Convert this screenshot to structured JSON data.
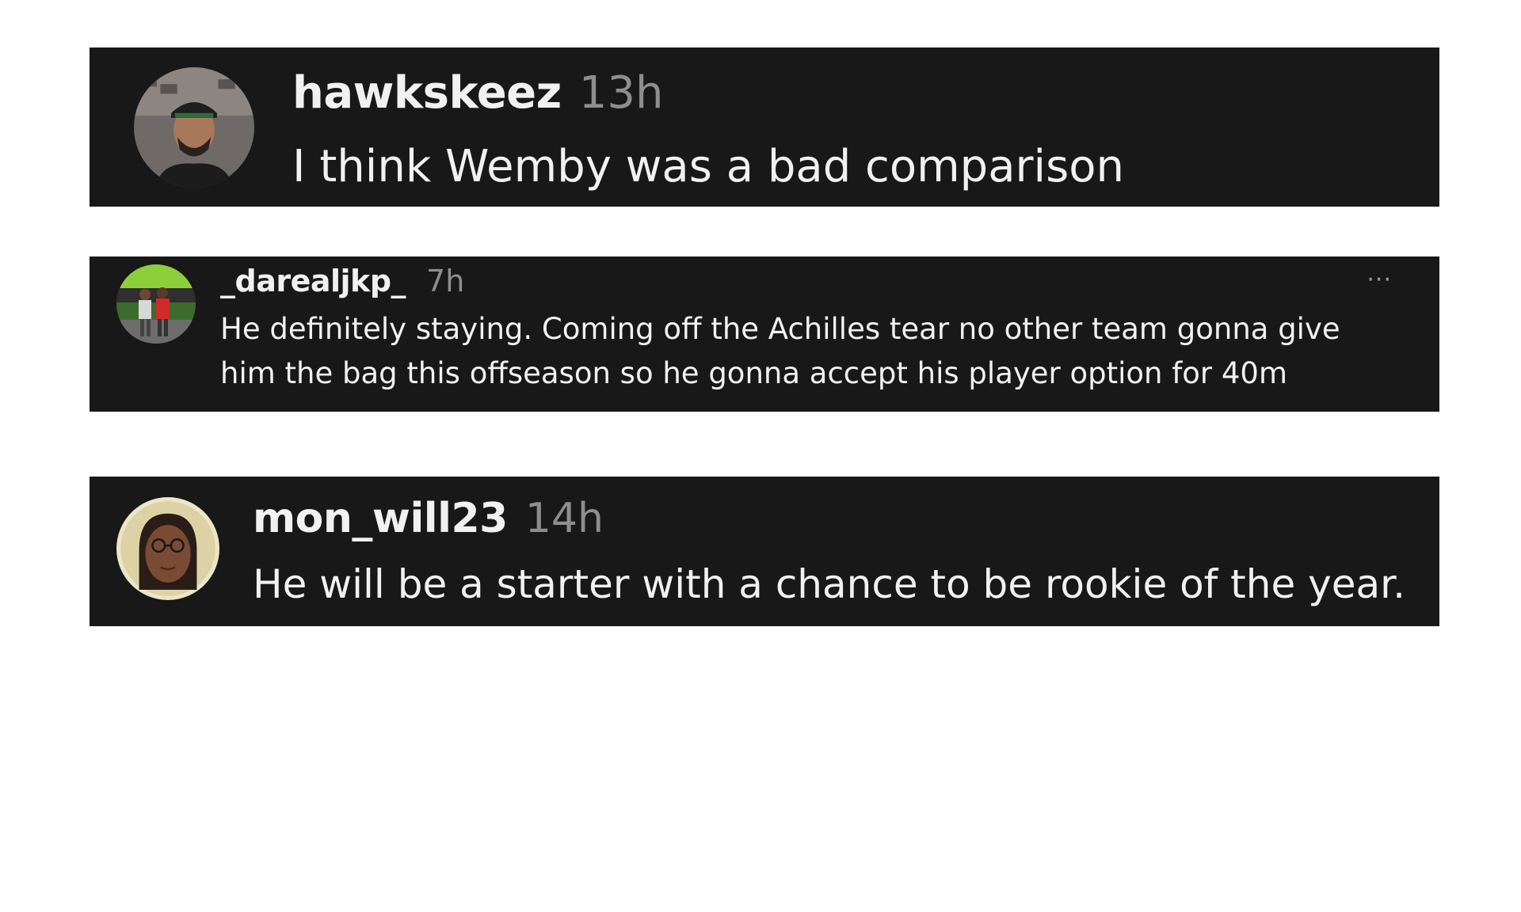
{
  "comments": [
    {
      "username": "hawkskeez",
      "time": "13h",
      "text": "I think Wemby was a bad comparison",
      "avatar_icon": "profile-photo-man-cap"
    },
    {
      "username": "_darealjkp_",
      "time": "7h",
      "text": "He definitely staying. Coming off the Achilles tear no other team gonna give him the bag this offseason so he gonna accept his player option for 40m",
      "more_label": "···",
      "avatar_icon": "profile-photo-two-people"
    },
    {
      "username": "mon_will23",
      "time": "14h",
      "text": "He will be a starter with a chance to be rookie of the year.",
      "avatar_icon": "profile-photo-woman-glasses"
    }
  ],
  "colors": {
    "card_background": "#181818",
    "text": "#f1f1f1",
    "muted": "#8e8e8e",
    "page_background": "#ffffff"
  }
}
